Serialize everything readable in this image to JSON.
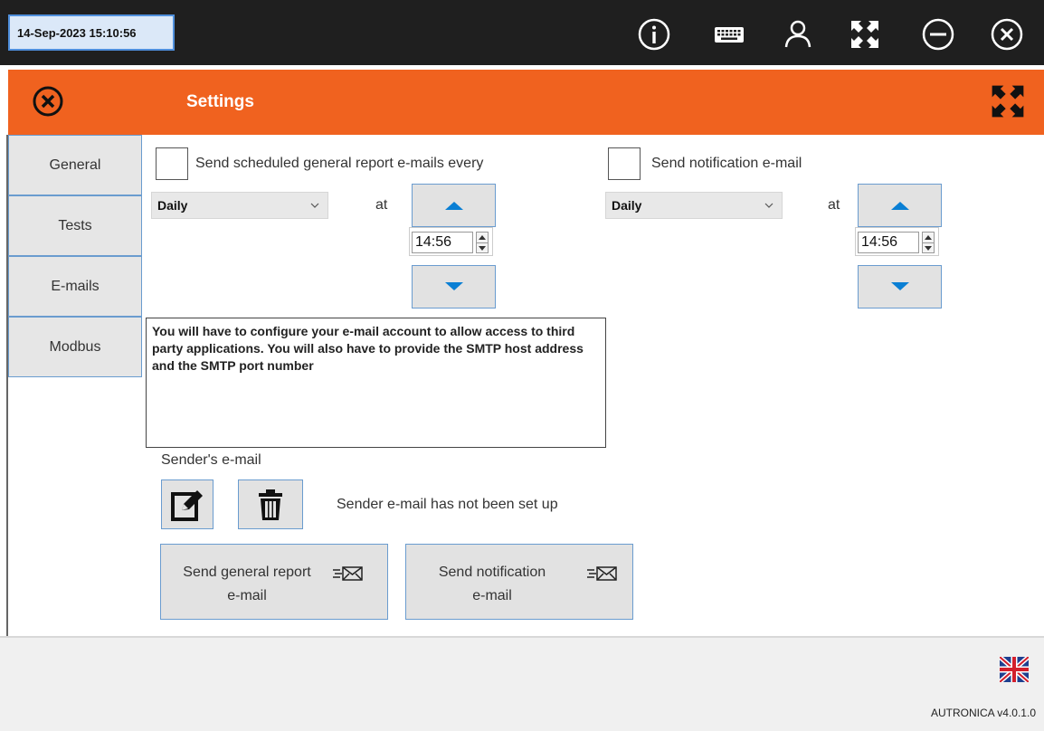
{
  "topbar": {
    "datetime": "14-Sep-2023 15:10:56",
    "icons": [
      "info-icon",
      "keyboard-icon",
      "user-icon",
      "fullscreen-icon",
      "minimize-icon",
      "close-icon"
    ]
  },
  "header": {
    "title": "Settings",
    "accent": "#f0621f"
  },
  "tabs": [
    {
      "label": "General"
    },
    {
      "label": "Tests"
    },
    {
      "label": "E-mails"
    },
    {
      "label": "Modbus"
    }
  ],
  "scheduled": {
    "checkbox_label": "Send scheduled general report e-mails every",
    "checked": false,
    "frequency": "Daily",
    "at_label": "at",
    "time": "14:56"
  },
  "notification": {
    "checkbox_label": "Send notification e-mail",
    "checked": false,
    "frequency": "Daily",
    "at_label": "at",
    "time": "14:56"
  },
  "info_text": "You will have to configure your e-mail account to allow access to third party applications. You will also have to provide the SMTP host address and the SMTP port number",
  "sender": {
    "label": "Sender's e-mail",
    "status": "Sender e-mail has not been set up"
  },
  "buttons": {
    "general_report": {
      "line1": "Send general report",
      "line2": "e-mail"
    },
    "notification": {
      "line1": "Send notification",
      "line2": "e-mail"
    }
  },
  "footer": {
    "version": "AUTRONICA v4.0.1.0",
    "language_icon": "uk-flag-icon"
  }
}
